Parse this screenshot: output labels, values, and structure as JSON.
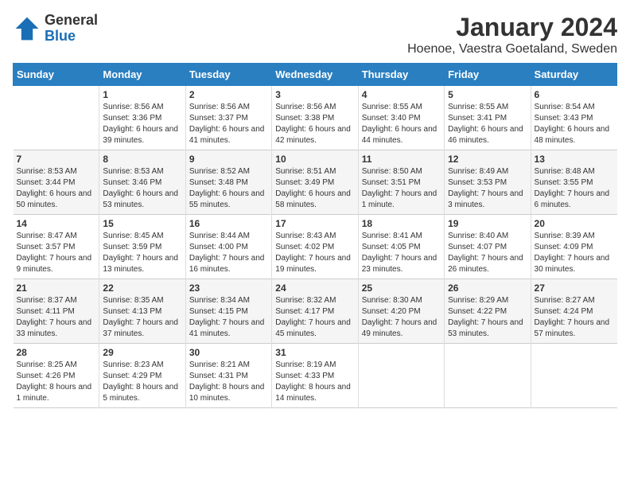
{
  "header": {
    "logo_general": "General",
    "logo_blue": "Blue",
    "month_title": "January 2024",
    "subtitle": "Hoenoe, Vaestra Goetaland, Sweden"
  },
  "days_of_week": [
    "Sunday",
    "Monday",
    "Tuesday",
    "Wednesday",
    "Thursday",
    "Friday",
    "Saturday"
  ],
  "weeks": [
    [
      {
        "day": "",
        "sunrise": "",
        "sunset": "",
        "daylight": ""
      },
      {
        "day": "1",
        "sunrise": "Sunrise: 8:56 AM",
        "sunset": "Sunset: 3:36 PM",
        "daylight": "Daylight: 6 hours and 39 minutes."
      },
      {
        "day": "2",
        "sunrise": "Sunrise: 8:56 AM",
        "sunset": "Sunset: 3:37 PM",
        "daylight": "Daylight: 6 hours and 41 minutes."
      },
      {
        "day": "3",
        "sunrise": "Sunrise: 8:56 AM",
        "sunset": "Sunset: 3:38 PM",
        "daylight": "Daylight: 6 hours and 42 minutes."
      },
      {
        "day": "4",
        "sunrise": "Sunrise: 8:55 AM",
        "sunset": "Sunset: 3:40 PM",
        "daylight": "Daylight: 6 hours and 44 minutes."
      },
      {
        "day": "5",
        "sunrise": "Sunrise: 8:55 AM",
        "sunset": "Sunset: 3:41 PM",
        "daylight": "Daylight: 6 hours and 46 minutes."
      },
      {
        "day": "6",
        "sunrise": "Sunrise: 8:54 AM",
        "sunset": "Sunset: 3:43 PM",
        "daylight": "Daylight: 6 hours and 48 minutes."
      }
    ],
    [
      {
        "day": "7",
        "sunrise": "Sunrise: 8:53 AM",
        "sunset": "Sunset: 3:44 PM",
        "daylight": "Daylight: 6 hours and 50 minutes."
      },
      {
        "day": "8",
        "sunrise": "Sunrise: 8:53 AM",
        "sunset": "Sunset: 3:46 PM",
        "daylight": "Daylight: 6 hours and 53 minutes."
      },
      {
        "day": "9",
        "sunrise": "Sunrise: 8:52 AM",
        "sunset": "Sunset: 3:48 PM",
        "daylight": "Daylight: 6 hours and 55 minutes."
      },
      {
        "day": "10",
        "sunrise": "Sunrise: 8:51 AM",
        "sunset": "Sunset: 3:49 PM",
        "daylight": "Daylight: 6 hours and 58 minutes."
      },
      {
        "day": "11",
        "sunrise": "Sunrise: 8:50 AM",
        "sunset": "Sunset: 3:51 PM",
        "daylight": "Daylight: 7 hours and 1 minute."
      },
      {
        "day": "12",
        "sunrise": "Sunrise: 8:49 AM",
        "sunset": "Sunset: 3:53 PM",
        "daylight": "Daylight: 7 hours and 3 minutes."
      },
      {
        "day": "13",
        "sunrise": "Sunrise: 8:48 AM",
        "sunset": "Sunset: 3:55 PM",
        "daylight": "Daylight: 7 hours and 6 minutes."
      }
    ],
    [
      {
        "day": "14",
        "sunrise": "Sunrise: 8:47 AM",
        "sunset": "Sunset: 3:57 PM",
        "daylight": "Daylight: 7 hours and 9 minutes."
      },
      {
        "day": "15",
        "sunrise": "Sunrise: 8:45 AM",
        "sunset": "Sunset: 3:59 PM",
        "daylight": "Daylight: 7 hours and 13 minutes."
      },
      {
        "day": "16",
        "sunrise": "Sunrise: 8:44 AM",
        "sunset": "Sunset: 4:00 PM",
        "daylight": "Daylight: 7 hours and 16 minutes."
      },
      {
        "day": "17",
        "sunrise": "Sunrise: 8:43 AM",
        "sunset": "Sunset: 4:02 PM",
        "daylight": "Daylight: 7 hours and 19 minutes."
      },
      {
        "day": "18",
        "sunrise": "Sunrise: 8:41 AM",
        "sunset": "Sunset: 4:05 PM",
        "daylight": "Daylight: 7 hours and 23 minutes."
      },
      {
        "day": "19",
        "sunrise": "Sunrise: 8:40 AM",
        "sunset": "Sunset: 4:07 PM",
        "daylight": "Daylight: 7 hours and 26 minutes."
      },
      {
        "day": "20",
        "sunrise": "Sunrise: 8:39 AM",
        "sunset": "Sunset: 4:09 PM",
        "daylight": "Daylight: 7 hours and 30 minutes."
      }
    ],
    [
      {
        "day": "21",
        "sunrise": "Sunrise: 8:37 AM",
        "sunset": "Sunset: 4:11 PM",
        "daylight": "Daylight: 7 hours and 33 minutes."
      },
      {
        "day": "22",
        "sunrise": "Sunrise: 8:35 AM",
        "sunset": "Sunset: 4:13 PM",
        "daylight": "Daylight: 7 hours and 37 minutes."
      },
      {
        "day": "23",
        "sunrise": "Sunrise: 8:34 AM",
        "sunset": "Sunset: 4:15 PM",
        "daylight": "Daylight: 7 hours and 41 minutes."
      },
      {
        "day": "24",
        "sunrise": "Sunrise: 8:32 AM",
        "sunset": "Sunset: 4:17 PM",
        "daylight": "Daylight: 7 hours and 45 minutes."
      },
      {
        "day": "25",
        "sunrise": "Sunrise: 8:30 AM",
        "sunset": "Sunset: 4:20 PM",
        "daylight": "Daylight: 7 hours and 49 minutes."
      },
      {
        "day": "26",
        "sunrise": "Sunrise: 8:29 AM",
        "sunset": "Sunset: 4:22 PM",
        "daylight": "Daylight: 7 hours and 53 minutes."
      },
      {
        "day": "27",
        "sunrise": "Sunrise: 8:27 AM",
        "sunset": "Sunset: 4:24 PM",
        "daylight": "Daylight: 7 hours and 57 minutes."
      }
    ],
    [
      {
        "day": "28",
        "sunrise": "Sunrise: 8:25 AM",
        "sunset": "Sunset: 4:26 PM",
        "daylight": "Daylight: 8 hours and 1 minute."
      },
      {
        "day": "29",
        "sunrise": "Sunrise: 8:23 AM",
        "sunset": "Sunset: 4:29 PM",
        "daylight": "Daylight: 8 hours and 5 minutes."
      },
      {
        "day": "30",
        "sunrise": "Sunrise: 8:21 AM",
        "sunset": "Sunset: 4:31 PM",
        "daylight": "Daylight: 8 hours and 10 minutes."
      },
      {
        "day": "31",
        "sunrise": "Sunrise: 8:19 AM",
        "sunset": "Sunset: 4:33 PM",
        "daylight": "Daylight: 8 hours and 14 minutes."
      },
      {
        "day": "",
        "sunrise": "",
        "sunset": "",
        "daylight": ""
      },
      {
        "day": "",
        "sunrise": "",
        "sunset": "",
        "daylight": ""
      },
      {
        "day": "",
        "sunrise": "",
        "sunset": "",
        "daylight": ""
      }
    ]
  ]
}
